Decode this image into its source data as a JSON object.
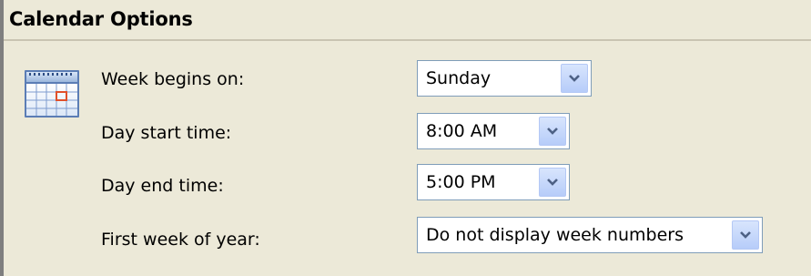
{
  "section": {
    "title": "Calendar Options",
    "icon": "calendar-icon"
  },
  "options": [
    {
      "label": "Week begins on:",
      "value": "Sunday"
    },
    {
      "label": "Day start time:",
      "value": "8:00 AM"
    },
    {
      "label": "Day end time:",
      "value": "5:00 PM"
    },
    {
      "label": "First week of year:",
      "value": "Do not display week numbers"
    }
  ],
  "colors": {
    "background": "#ECE9D8",
    "field_border": "#7F9DB9",
    "button_face": "#C7D8FB",
    "arrow": "#4D6185",
    "calendar_highlight": "#E0502A"
  }
}
